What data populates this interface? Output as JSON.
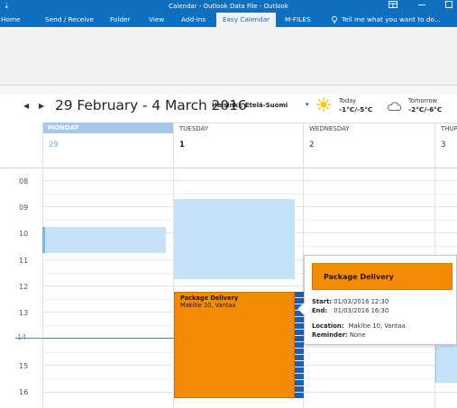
{
  "window": {
    "title": "Calendar - Outlook Data File - Outlook",
    "quick_access_glyph": "⇣"
  },
  "ribbon": {
    "tabs": [
      {
        "label": "Home"
      },
      {
        "label": "Send / Receive"
      },
      {
        "label": "Folder"
      },
      {
        "label": "View"
      },
      {
        "label": "Add-ins"
      },
      {
        "label": "Easy Calendar"
      },
      {
        "label": "M-FILES"
      }
    ],
    "active_tab": "Easy Calendar",
    "tell_me": "Tell me what you want to do..."
  },
  "calendar": {
    "prev_glyph": "◀",
    "next_glyph": "▶",
    "date_range": "29 February - 4 March 2016",
    "location": "Helsinki, Etelä-Suomi",
    "location_caret": "▾",
    "weather": {
      "today_label": "Today",
      "today_temp": "-1°C/-5°C",
      "tomorrow_label": "Tomorrow",
      "tomorrow_temp": "-2°C/-6°C"
    },
    "days": [
      {
        "name": "MONDAY",
        "date": "29"
      },
      {
        "name": "TUESDAY",
        "date": "1"
      },
      {
        "name": "WEDNESDAY",
        "date": "2"
      },
      {
        "name": "THURSDAY",
        "date": "3"
      }
    ],
    "hours": [
      "08",
      "09",
      "10",
      "11",
      "12",
      "13",
      "14",
      "15",
      "16"
    ],
    "now_marker": "14"
  },
  "events": {
    "package": {
      "title": "Package Delivery",
      "location": "Makitie 10, Vantaa"
    }
  },
  "popup": {
    "title": "Package Delivery",
    "start_label": "Start:",
    "start_value": "01/03/2016   12:30",
    "end_label": "End:",
    "end_value": "01/03/2016   16:30",
    "location_label": "Location:",
    "location_value": "Makitie 10, Vantaa",
    "reminder_label": "Reminder:",
    "reminder_value": "None"
  },
  "colors": {
    "ribbon_blue": "#106ebe",
    "event_orange": "#f58a07",
    "event_blue": "#c5e3f8",
    "monday_header": "#a6c8ee"
  }
}
